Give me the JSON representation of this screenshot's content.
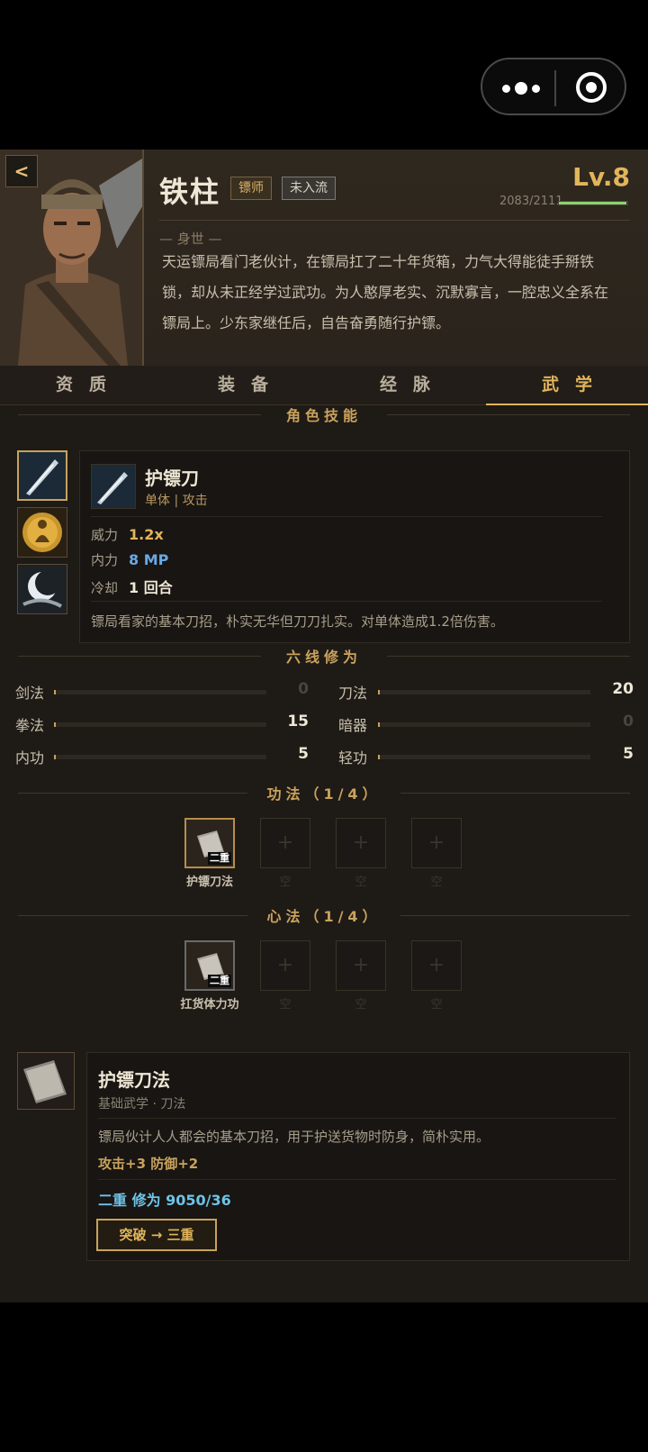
{
  "colors": {
    "accent": "#e2b55a",
    "exp": "#8ed26a",
    "mp": "#6aa8e6",
    "progress": "#6ec3e6"
  },
  "header": {
    "back_label": "<",
    "name": "铁柱",
    "role": "镖师",
    "rank": "未入流",
    "level": "Lv.8",
    "exp_text": "2083/2111",
    "exp_fraction": 0.986,
    "bio_title": "— 身世 —",
    "bio": "天运镖局看门老伙计，在镖局扛了二十年货箱，力气大得能徒手掰铁锁，却从未正经学过武功。为人憨厚老实、沉默寡言，一腔忠义全系在镖局上。少东家继任后，自告奋勇随行护镖。"
  },
  "tabs": [
    "资质",
    "装备",
    "经脉",
    "武学"
  ],
  "active_tab": 3,
  "skills": {
    "title": "角色技能",
    "icons": [
      "blade-skill-icon",
      "meditate-skill-icon",
      "moon-slash-skill-icon"
    ],
    "selected": {
      "name": "护镖刀",
      "tags": "单体 | 攻击",
      "power_label": "威力",
      "power_value": "1.2x",
      "mp_label": "内力",
      "mp_value": "8 MP",
      "cd_label": "冷却",
      "cd_value": "1 回合",
      "desc": "镖局看家的基本刀招，朴实无华但刀刀扎实。对单体造成1.2倍伤害。"
    }
  },
  "six_lines": {
    "title": "六线修为",
    "items": [
      {
        "label": "剑法",
        "value": "0"
      },
      {
        "label": "刀法",
        "value": "20"
      },
      {
        "label": "拳法",
        "value": "15"
      },
      {
        "label": "暗器",
        "value": "0"
      },
      {
        "label": "内功",
        "value": "5"
      },
      {
        "label": "轻功",
        "value": "5"
      }
    ]
  },
  "gongfa": {
    "title": "功法（1/4）",
    "slots": [
      {
        "label": "护镖刀法",
        "tier": "二重",
        "filled": true
      },
      {
        "label": "空",
        "tier": "",
        "filled": false
      },
      {
        "label": "空",
        "tier": "",
        "filled": false
      },
      {
        "label": "空",
        "tier": "",
        "filled": false
      }
    ],
    "plus": "+"
  },
  "xinfa": {
    "title": "心法（1/4）",
    "slots": [
      {
        "label": "扛货体力功",
        "tier": "二重",
        "filled": true
      },
      {
        "label": "空",
        "tier": "",
        "filled": false
      },
      {
        "label": "空",
        "tier": "",
        "filled": false
      },
      {
        "label": "空",
        "tier": "",
        "filled": false
      }
    ],
    "plus": "+"
  },
  "detail": {
    "name": "护镖刀法",
    "tags": "基础武学 · 刀法",
    "desc": "镖局伙计人人都会的基本刀招，用于护送货物时防身，简朴实用。",
    "bonus": "攻击+3  防御+2",
    "progress": "二重  修为 9050/36",
    "breakthrough": "突破 → 三重"
  }
}
